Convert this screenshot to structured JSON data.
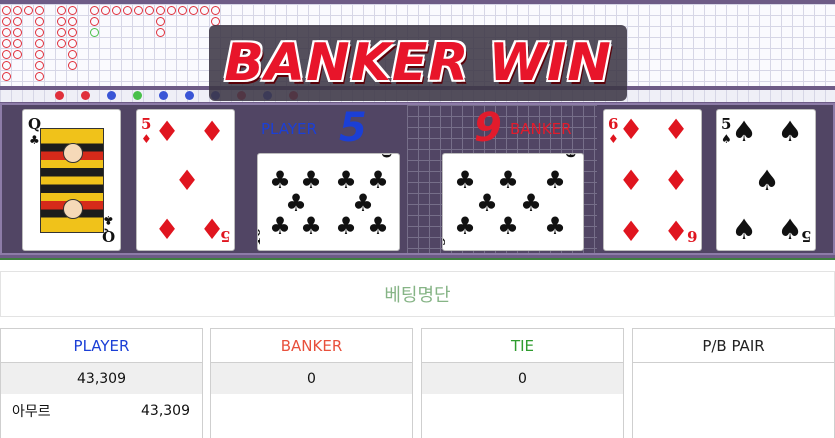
{
  "banner": {
    "text": "BANKER WIN"
  },
  "player": {
    "label": "PLAYER",
    "score": "5",
    "cards": [
      {
        "rank": "Q",
        "suit": "clubs"
      },
      {
        "rank": "5",
        "suit": "diamonds"
      },
      {
        "rank": "10",
        "suit": "clubs"
      }
    ]
  },
  "banker": {
    "label": "BANKER",
    "score": "9",
    "cards": [
      {
        "rank": "9",
        "suit": "clubs"
      },
      {
        "rank": "6",
        "suit": "diamonds"
      },
      {
        "rank": "5",
        "suit": "spades"
      }
    ]
  },
  "colors": {
    "player": "#1b3fd6",
    "banker": "#e21b2c",
    "tie": "#2f9c2f",
    "pair": "#222222",
    "header": "#86b486"
  },
  "betting": {
    "title": "베팅명단",
    "columns": [
      {
        "label": "PLAYER",
        "color": "#1b3fd6",
        "total": "43,309",
        "rows": [
          {
            "name": "아무르",
            "amount": "43,309"
          }
        ]
      },
      {
        "label": "BANKER",
        "color": "#e8503c",
        "total": "0",
        "rows": []
      },
      {
        "label": "TIE",
        "color": "#2f9c2f",
        "total": "0",
        "rows": []
      },
      {
        "label": "P/B PAIR",
        "color": "#222222",
        "total": "",
        "rows": []
      }
    ]
  }
}
